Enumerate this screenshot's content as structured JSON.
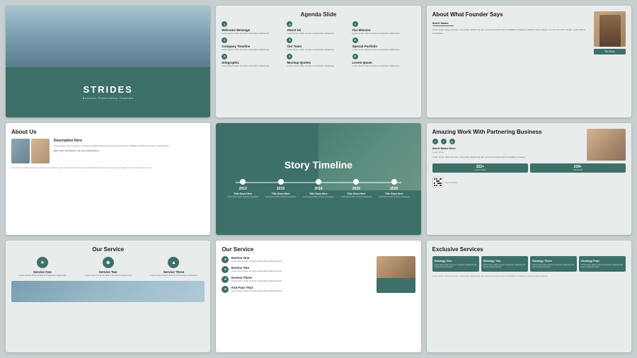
{
  "slides": {
    "slide1": {
      "brand": "STRIDES",
      "tagline": "Business Presentation Template"
    },
    "slide2": {
      "title": "Agenda Slide",
      "items": [
        {
          "num": "1",
          "label": "Welcome Message",
          "text": "Lorem ipsum dolor sit amet consectetur adipiscing"
        },
        {
          "num": "2",
          "label": "Company Timeline",
          "text": "Lorem ipsum dolor sit amet consectetur adipiscing"
        },
        {
          "num": "3",
          "label": "Infographic",
          "text": "Lorem ipsum dolor sit amet consectetur adipiscing"
        },
        {
          "num": "4",
          "label": "About Us",
          "text": "Lorem ipsum dolor sit amet consectetur adipiscing"
        },
        {
          "num": "5",
          "label": "Our Team",
          "text": "Lorem ipsum dolor sit amet consectetur adipiscing"
        },
        {
          "num": "6",
          "label": "Mockup Quotes",
          "text": "Lorem ipsum dolor sit amet consectetur adipiscing"
        },
        {
          "num": "7",
          "label": "Our Mission",
          "text": "Lorem ipsum dolor sit amet consectetur adipiscing"
        },
        {
          "num": "8",
          "label": "Special Portfolio",
          "text": "Lorem ipsum dolor sit amet consectetur adipiscing"
        },
        {
          "num": "9",
          "label": "Lorem Ipsum",
          "text": "Lorem ipsum dolor sit amet consectetur adipiscing"
        }
      ]
    },
    "slide3": {
      "title": "About What Founder Says",
      "name": "Insert Name",
      "role": "The Boss",
      "desc": "Lorem ipsum dolor sit amet, consectetur adipiscing elit, sed do eiusmod tempor incididunt ut labore et dolore magna aliqua. Ut enim ad minim veniam, quis nostrud exercitation."
    },
    "slide4": {
      "title": "About Us",
      "description_title": "Description Here",
      "description": "Lorem ipsum dolor sit amet, consectetur adipiscing elit, sed do eiusmod tempor incididunt ut labore et dolore magna aliqua.",
      "more": "More Text: Key Names, No User Informations",
      "bottom": "Lorem ipsum dolor sit amet, consectetur adipiscing elit, sed do eiusmod tempor incididunt ut labore et dolore magna aliqua. Ut enim ad minim veniam."
    },
    "slide5": {
      "title": "Story Timeline",
      "points": [
        {
          "year": "2013",
          "title": "Title Goes Here",
          "text": "Lorem ipsum dolor sit amet consectetur"
        },
        {
          "year": "2015",
          "title": "Title Goes Here",
          "text": "Lorem ipsum dolor sit amet consectetur"
        },
        {
          "year": "2019",
          "title": "Title Goes Here",
          "text": "Lorem ipsum dolor sit amet consectetur"
        },
        {
          "year": "2022",
          "title": "Title Goes Here",
          "text": "Lorem ipsum dolor sit amet consectetur"
        },
        {
          "year": "2025",
          "title": "Title Goes Here",
          "text": "Lorem ipsum dolor sit amet consectetur"
        }
      ]
    },
    "slide6": {
      "title": "Amazing Work With Partnering Business",
      "name": "Insert Name Here",
      "role": "Lorem ipsum",
      "desc": "Lorem ipsum dolor sit amet, consectetur adipiscing elit, sed do eiusmod tempor incididunt ut labore.",
      "stat1_num": "322+",
      "stat1_label": "Custom Detail",
      "stat2_num": "239+",
      "stat2_label": "Total Details",
      "qr_text": "Insert Details"
    },
    "slide7": {
      "title": "Our Service",
      "services": [
        {
          "icon": "★",
          "name": "Service One",
          "desc": "Lorem ipsum dolor sit amet consectetur adipiscing"
        },
        {
          "icon": "◆",
          "name": "Service Two",
          "desc": "Lorem ipsum dolor sit amet consectetur adipiscing"
        },
        {
          "icon": "▲",
          "name": "Service Three",
          "desc": "Lorem ipsum dolor sit amet consectetur adipiscing"
        }
      ]
    },
    "slide8": {
      "title": "Our Service",
      "services": [
        {
          "icon": "●",
          "name": "Service One",
          "desc": "Lorem ipsum dolor sit amet consectetur adipiscing elit"
        },
        {
          "icon": "●",
          "name": "Service Two",
          "desc": "Lorem ipsum dolor sit amet consectetur adipiscing elit"
        },
        {
          "icon": "●",
          "name": "Service Three",
          "desc": "Lorem ipsum dolor sit amet consectetur adipiscing elit"
        },
        {
          "icon": "●",
          "name": "And Four That",
          "desc": "Lorem ipsum dolor sit amet consectetur adipiscing elit"
        }
      ]
    },
    "slide9": {
      "title": "Exclusive Services",
      "cards": [
        {
          "title": "Strategy One",
          "text": "Lorem ipsum dolor sit amet consectetur adipiscing elit sed do eiusmod tempor"
        },
        {
          "title": "Strategy Two",
          "text": "Lorem ipsum dolor sit amet consectetur adipiscing elit sed do eiusmod tempor"
        },
        {
          "title": "Strategy Three",
          "text": "Lorem ipsum dolor sit amet consectetur adipiscing elit sed do eiusmod tempor"
        },
        {
          "title": "Strategy Four",
          "text": "Lorem ipsum dolor sit amet consectetur adipiscing elit sed do eiusmod tempor"
        }
      ],
      "bottom": "Lorem ipsum dolor sit amet, consectetur adipiscing elit, sed do eiusmod tempor incididunt ut labore et dolore magna aliqua."
    }
  }
}
